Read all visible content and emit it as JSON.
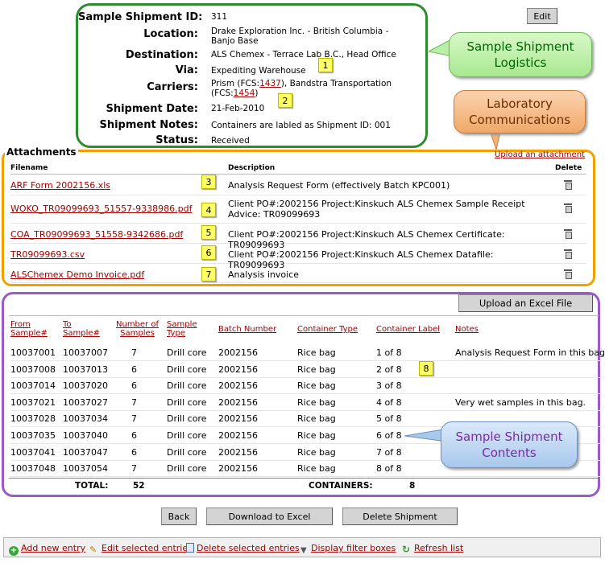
{
  "logistics": {
    "id_label": "Sample Shipment ID:",
    "id_value": "311",
    "location_label": "Location:",
    "location_value": "Drake Exploration Inc. - British Columbia - Banjo Base",
    "destination_label": "Destination:",
    "destination_value": "ALS Chemex - Terrace Lab B.C., Head Office",
    "via_label": "Via:",
    "via_value": "Expediting Warehouse",
    "carriers_label": "Carriers:",
    "carrier1_prefix": "Prism (FCS:",
    "carrier1_link": "1437",
    "carrier1_suffix": "), Bandstra Transportation",
    "carrier2_prefix": "(FCS:",
    "carrier2_link": "1454",
    "carrier2_suffix": ")",
    "date_label": "Shipment Date:",
    "date_value": "21-Feb-2010",
    "notes_label": "Shipment Notes:",
    "notes_value": "Containers are labled as Shipment ID: 001",
    "status_label": "Status:",
    "status_value": "Received"
  },
  "edit_button": "Edit",
  "callouts": {
    "logistics": "Sample Shipment Logistics",
    "lab": "Laboratory Communications",
    "contents": "Sample Shipment Contents"
  },
  "markers": [
    "1",
    "2",
    "3",
    "4",
    "5",
    "6",
    "7",
    "8"
  ],
  "attachments": {
    "title": "Attachments",
    "upload_link": "Upload an attachment",
    "headers": {
      "filename": "Filename",
      "description": "Description",
      "delete": "Delete"
    },
    "rows": [
      {
        "file": "ARF Form 2002156.xls",
        "desc": "Analysis Request Form (effectively Batch KPC001)"
      },
      {
        "file": "WOKO_TR09099693_51557-9338986.pdf",
        "desc": "Client PO#:2002156 Project:Kinskuch ALS Chemex Sample Receipt Advice: TR09099693"
      },
      {
        "file": "COA_TR09099693_51558-9342686.pdf",
        "desc": "Client PO#:2002156 Project:Kinskuch ALS Chemex Certificate: TR09099693"
      },
      {
        "file": "TR09099693.csv",
        "desc": "Client PO#:2002156 Project:Kinskuch ALS Chemex Datafile: TR09099693"
      },
      {
        "file": "ALSChemex Demo Invoice.pdf",
        "desc": "Analysis invoice"
      }
    ]
  },
  "upload_excel_button": "Upload an Excel File",
  "contents": {
    "headers": {
      "from": [
        "From",
        "Sample#"
      ],
      "to": [
        "To",
        "Sample#"
      ],
      "num": [
        "Number of",
        "Samples"
      ],
      "type": [
        "Sample",
        "Type"
      ],
      "batch": "Batch Number",
      "container": "Container Type",
      "label": "Container Label",
      "notes": "Notes"
    },
    "rows": [
      {
        "from": "10037001",
        "to": "10037007",
        "num": "7",
        "type": "Drill core",
        "batch": "2002156",
        "container": "Rice bag",
        "label": "1 of 8",
        "notes": "Analysis Request Form in this bag."
      },
      {
        "from": "10037008",
        "to": "10037013",
        "num": "6",
        "type": "Drill core",
        "batch": "2002156",
        "container": "Rice bag",
        "label": "2 of 8",
        "notes": ""
      },
      {
        "from": "10037014",
        "to": "10037020",
        "num": "6",
        "type": "Drill core",
        "batch": "2002156",
        "container": "Rice bag",
        "label": "3 of 8",
        "notes": ""
      },
      {
        "from": "10037021",
        "to": "10037027",
        "num": "7",
        "type": "Drill core",
        "batch": "2002156",
        "container": "Rice bag",
        "label": "4 of 8",
        "notes": "Very wet samples in this bag."
      },
      {
        "from": "10037028",
        "to": "10037034",
        "num": "7",
        "type": "Drill core",
        "batch": "2002156",
        "container": "Rice bag",
        "label": "5 of 8",
        "notes": ""
      },
      {
        "from": "10037035",
        "to": "10037040",
        "num": "6",
        "type": "Drill core",
        "batch": "2002156",
        "container": "Rice bag",
        "label": "6 of 8",
        "notes": ""
      },
      {
        "from": "10037041",
        "to": "10037047",
        "num": "6",
        "type": "Drill core",
        "batch": "2002156",
        "container": "Rice bag",
        "label": "7 of 8",
        "notes": ""
      },
      {
        "from": "10037048",
        "to": "10037054",
        "num": "7",
        "type": "Drill core",
        "batch": "2002156",
        "container": "Rice bag",
        "label": "8 of 8",
        "notes": ""
      }
    ],
    "total_label": "TOTAL:",
    "total_value": "52",
    "containers_label": "CONTAINERS:",
    "containers_value": "8"
  },
  "buttons": {
    "back": "Back",
    "download": "Download to Excel",
    "delete_shipment": "Delete Shipment"
  },
  "toolbar": {
    "add": "Add new entry",
    "edit": "Edit selected entries",
    "delete": "Delete selected entries",
    "filter": "Display filter boxes",
    "refresh": "Refresh list"
  },
  "colors": {
    "logistics_border": "#2e8b2e",
    "attach_border": "#f0a000",
    "contents_border": "#9b59c9",
    "link": "#a00000",
    "marker": "#ffff66"
  }
}
